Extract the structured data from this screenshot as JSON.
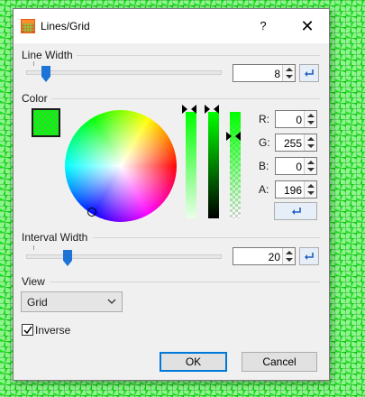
{
  "window": {
    "title": "Lines/Grid",
    "help_label": "?",
    "close_label": "✕",
    "icon": "grid-app-icon"
  },
  "line_width": {
    "label": "Line Width",
    "value": "8",
    "slider_fraction": 0.1
  },
  "color": {
    "label": "Color",
    "current": "#00ff00",
    "alpha_hex": "#00ff00c4",
    "r_label": "R:",
    "r_value": "0",
    "g_label": "G:",
    "g_value": "255",
    "b_label": "B:",
    "b_value": "0",
    "a_label": "A:",
    "a_value": "196"
  },
  "interval_width": {
    "label": "Interval Width",
    "value": "20",
    "slider_fraction": 0.2
  },
  "view": {
    "label": "View",
    "selected": "Grid"
  },
  "inverse": {
    "label": "Inverse",
    "checked": true
  },
  "buttons": {
    "ok": "OK",
    "cancel": "Cancel"
  },
  "icons": [
    "grid-app-icon",
    "help-icon",
    "close-icon",
    "reset-arrow-icon",
    "spin-up-icon",
    "spin-down-icon",
    "chevron-down-icon",
    "checkmark-icon"
  ]
}
